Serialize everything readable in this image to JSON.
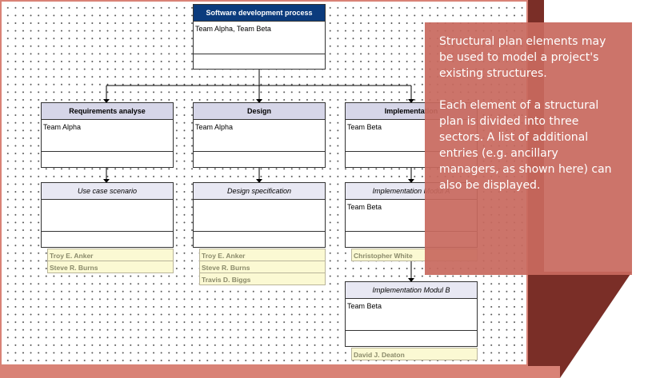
{
  "diagram": {
    "root": {
      "title": "Software development process",
      "team": "Team Alpha, Team Beta"
    },
    "branches": [
      {
        "title": "Requirements analyse",
        "team": "Team Alpha",
        "sub": {
          "title": "Use case scenario",
          "team": "",
          "entries": [
            "Troy E. Anker",
            "Steve R. Burns"
          ]
        }
      },
      {
        "title": "Design",
        "team": "Team Alpha",
        "sub": {
          "title": "Design specification",
          "team": "",
          "entries": [
            "Troy E. Anker",
            "Steve R. Burns",
            "Travis D. Biggs"
          ]
        }
      },
      {
        "title": "Implementation",
        "team": "Team Beta",
        "sub": {
          "title": "Implementation Modul A",
          "team": "Team Beta",
          "entries": [
            "Christopher White"
          ]
        },
        "sub2": {
          "title": "Implementation Modul B",
          "team": "Team Beta",
          "entries": [
            "David J. Deaton"
          ]
        }
      }
    ]
  },
  "callout": {
    "paragraph1": "Structural plan elements may be used to model a project's existing structures.",
    "paragraph2": "Each element of a structural plan is divided into three sectors. A list of additional entries (e.g. ancillary managers, as shown here) can also be displayed."
  },
  "colors": {
    "root_header": "#0b3b7d",
    "node_header": "#d6d6e8",
    "entry_bg": "#fbf9d3",
    "callout": "#c8695f",
    "shadow": "#7a2e27"
  }
}
